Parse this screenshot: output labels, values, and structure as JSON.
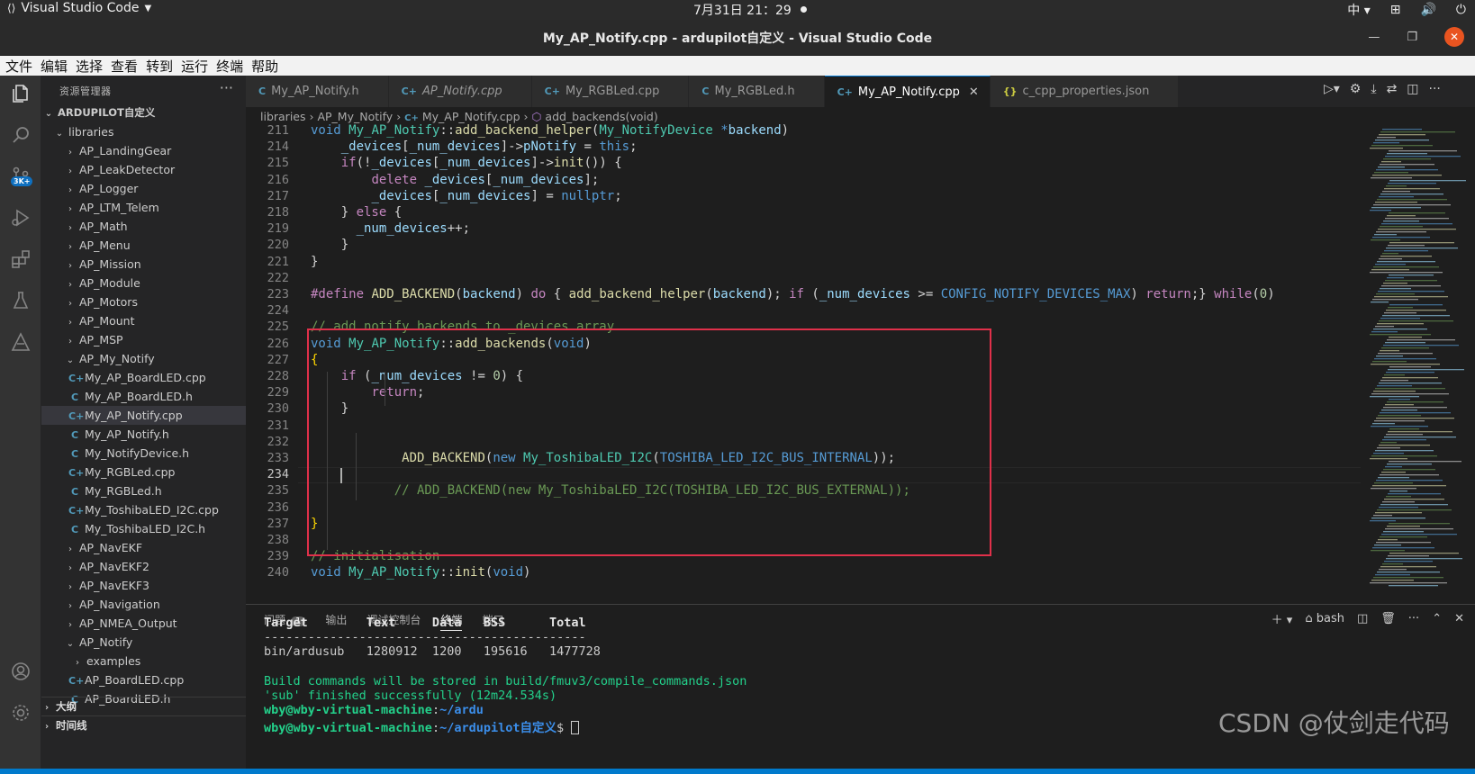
{
  "os": {
    "app": "Visual Studio Code",
    "clock": "7月31日  21：29",
    "ime": "中"
  },
  "window": {
    "title": "My_AP_Notify.cpp - ardupilot自定义 - Visual Studio Code"
  },
  "menu": [
    "文件",
    "编辑",
    "选择",
    "查看",
    "转到",
    "运行",
    "终端",
    "帮助"
  ],
  "activity": {
    "scm_badge": "3K+"
  },
  "explorer": {
    "header": "资源管理器",
    "root": "ARDUPILOT自定义",
    "folder": "libraries",
    "items": [
      {
        "label": "AP_LandingGear",
        "kind": "folder",
        "depth": 2,
        "open": false
      },
      {
        "label": "AP_LeakDetector",
        "kind": "folder",
        "depth": 2,
        "open": false
      },
      {
        "label": "AP_Logger",
        "kind": "folder",
        "depth": 2,
        "open": false
      },
      {
        "label": "AP_LTM_Telem",
        "kind": "folder",
        "depth": 2,
        "open": false
      },
      {
        "label": "AP_Math",
        "kind": "folder",
        "depth": 2,
        "open": false
      },
      {
        "label": "AP_Menu",
        "kind": "folder",
        "depth": 2,
        "open": false
      },
      {
        "label": "AP_Mission",
        "kind": "folder",
        "depth": 2,
        "open": false
      },
      {
        "label": "AP_Module",
        "kind": "folder",
        "depth": 2,
        "open": false
      },
      {
        "label": "AP_Motors",
        "kind": "folder",
        "depth": 2,
        "open": false
      },
      {
        "label": "AP_Mount",
        "kind": "folder",
        "depth": 2,
        "open": false
      },
      {
        "label": "AP_MSP",
        "kind": "folder",
        "depth": 2,
        "open": false
      },
      {
        "label": "AP_My_Notify",
        "kind": "folder",
        "depth": 2,
        "open": true
      },
      {
        "label": "My_AP_BoardLED.cpp",
        "kind": "cpp",
        "depth": 3
      },
      {
        "label": "My_AP_BoardLED.h",
        "kind": "c",
        "depth": 3
      },
      {
        "label": "My_AP_Notify.cpp",
        "kind": "cpp",
        "depth": 3,
        "selected": true
      },
      {
        "label": "My_AP_Notify.h",
        "kind": "c",
        "depth": 3
      },
      {
        "label": "My_NotifyDevice.h",
        "kind": "c",
        "depth": 3
      },
      {
        "label": "My_RGBLed.cpp",
        "kind": "cpp",
        "depth": 3
      },
      {
        "label": "My_RGBLed.h",
        "kind": "c",
        "depth": 3
      },
      {
        "label": "My_ToshibaLED_I2C.cpp",
        "kind": "cpp",
        "depth": 3
      },
      {
        "label": "My_ToshibaLED_I2C.h",
        "kind": "c",
        "depth": 3
      },
      {
        "label": "AP_NavEKF",
        "kind": "folder",
        "depth": 2,
        "open": false
      },
      {
        "label": "AP_NavEKF2",
        "kind": "folder",
        "depth": 2,
        "open": false
      },
      {
        "label": "AP_NavEKF3",
        "kind": "folder",
        "depth": 2,
        "open": false
      },
      {
        "label": "AP_Navigation",
        "kind": "folder",
        "depth": 2,
        "open": false
      },
      {
        "label": "AP_NMEA_Output",
        "kind": "folder",
        "depth": 2,
        "open": false
      },
      {
        "label": "AP_Notify",
        "kind": "folder",
        "depth": 2,
        "open": true
      },
      {
        "label": "examples",
        "kind": "folder",
        "depth": 3,
        "open": false
      },
      {
        "label": "AP_BoardLED.cpp",
        "kind": "cpp",
        "depth": 3
      },
      {
        "label": "AP_BoardLED.h",
        "kind": "c",
        "depth": 3
      }
    ],
    "sections": [
      "大纲",
      "时间线"
    ]
  },
  "tabs": [
    {
      "label": "My_AP_Notify.h",
      "icon": "C"
    },
    {
      "label": "AP_Notify.cpp",
      "icon": "C+"
    },
    {
      "label": "My_RGBLed.cpp",
      "icon": "C+"
    },
    {
      "label": "My_RGBLed.h",
      "icon": "C"
    },
    {
      "label": "My_AP_Notify.cpp",
      "icon": "C+",
      "active": true
    },
    {
      "label": "c_cpp_properties.json",
      "icon": "{}"
    }
  ],
  "breadcrumb": [
    "libraries",
    "AP_My_Notify",
    "My_AP_Notify.cpp",
    "add_backends(void)"
  ],
  "editor": {
    "current_line": 234,
    "lines": [
      {
        "n": 211,
        "html": "<span class='kw'>void</span> <span class='ty'>My_AP_Notify</span>::<span class='fn'>add_backend_helper</span>(<span class='ty'>My_NotifyDevice</span> <span class='kw'>*</span><span class='var'>backend</span>)"
      },
      {
        "n": 214,
        "html": "    <span class='var'>_devices</span>[<span class='var'>_num_devices</span>]-><span class='var'>pNotify</span> = <span class='kw'>this</span>;"
      },
      {
        "n": 215,
        "html": "    <span class='pp'>if</span>(!<span class='var'>_devices</span>[<span class='var'>_num_devices</span>]-><span class='fn'>init</span>()) {"
      },
      {
        "n": 216,
        "html": "        <span class='pp'>delete</span> <span class='var'>_devices</span>[<span class='var'>_num_devices</span>];"
      },
      {
        "n": 217,
        "html": "        <span class='var'>_devices</span>[<span class='var'>_num_devices</span>] = <span class='kw'>nullptr</span>;"
      },
      {
        "n": 218,
        "html": "    } <span class='pp'>else</span> {"
      },
      {
        "n": 219,
        "html": "      <span class='var'>_num_devices</span>++;"
      },
      {
        "n": 220,
        "html": "    }"
      },
      {
        "n": 221,
        "html": "}"
      },
      {
        "n": 222,
        "html": ""
      },
      {
        "n": 223,
        "html": "<span class='pp'>#define</span> <span class='fn'>ADD_BACKEND</span>(<span class='var'>backend</span>) <span class='pp'>do</span> { <span class='fn'>add_backend_helper</span>(<span class='var'>backend</span>); <span class='pp'>if</span> (<span class='var'>_num_devices</span> >= <span class='mac'>CONFIG_NOTIFY_DEVICES_MAX</span>) <span class='pp'>return</span>;} <span class='pp'>while</span>(<span class='num'>0</span>)"
      },
      {
        "n": 224,
        "html": ""
      },
      {
        "n": 225,
        "html": "<span class='cm'>// add notify backends to _devices array</span>"
      },
      {
        "n": 226,
        "html": "<span class='kw'>void</span> <span class='ty'>My_AP_Notify</span>::<span class='fn'>add_backends</span>(<span class='kw'>void</span>)"
      },
      {
        "n": 227,
        "html": "<span class='br'>{</span>"
      },
      {
        "n": 228,
        "html": "    <span class='pp'>if</span> (<span class='var'>_num_devices</span> != <span class='num'>0</span>) {"
      },
      {
        "n": 229,
        "html": "        <span class='pp'>return</span>;"
      },
      {
        "n": 230,
        "html": "    }"
      },
      {
        "n": 231,
        "html": ""
      },
      {
        "n": 232,
        "html": ""
      },
      {
        "n": 233,
        "html": "            <span class='fn'>ADD_BACKEND</span>(<span class='kw'>new</span> <span class='ty'>My_ToshibaLED_I2C</span>(<span class='mac'>TOSHIBA_LED_I2C_BUS_INTERNAL</span>));"
      },
      {
        "n": 234,
        "html": ""
      },
      {
        "n": 235,
        "html": "           <span class='cm'>// ADD_BACKEND(new My_ToshibaLED_I2C(TOSHIBA_LED_I2C_BUS_EXTERNAL));</span>"
      },
      {
        "n": 236,
        "html": ""
      },
      {
        "n": 237,
        "html": "<span class='br'>}</span>"
      },
      {
        "n": 238,
        "html": ""
      },
      {
        "n": 239,
        "html": "<span class='cm'>// initialisation</span>"
      },
      {
        "n": 240,
        "html": "<span class='kw'>void</span> <span class='ty'>My_AP_Notify</span>::<span class='fn'>init</span>(<span class='kw'>void</span>)"
      }
    ]
  },
  "panel": {
    "tabs": [
      "问题",
      "输出",
      "调试控制台",
      "终端",
      "端口"
    ],
    "problems_count": "1",
    "active_tab": "终端",
    "shell": "bash",
    "terminal": {
      "header": "Target        Text     Data   BSS      Total",
      "divider": "--------------------------------------------",
      "row": "bin/ardusub   1280912  1200   195616   1477728",
      "build1": "Build commands will be stored in build/fmuv3/compile_commands.json",
      "build2": "'sub' finished successfully (12m24.534s)",
      "prompt1_user": "wby@wby-virtual-machine",
      "prompt1_path": "~/ardu",
      "prompt2_user": "wby@wby-virtual-machine",
      "prompt2_path": "~/ardupilot自定义",
      "prompt_symbol": "$"
    }
  },
  "watermark": "CSDN @仗剑走代码"
}
